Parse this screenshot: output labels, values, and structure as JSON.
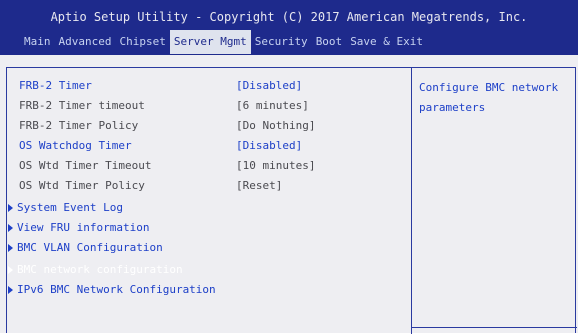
{
  "header": {
    "title": "Aptio Setup Utility - Copyright (C) 2017 American Megatrends, Inc.",
    "tabs": [
      "Main",
      "Advanced",
      "Chipset",
      "Server Mgmt",
      "Security",
      "Boot",
      "Save & Exit"
    ],
    "active_tab": "Server Mgmt"
  },
  "settings": [
    {
      "label": "FRB-2 Timer",
      "value": "[Disabled]"
    },
    {
      "label": "FRB-2 Timer timeout",
      "value": "[6 minutes]"
    },
    {
      "label": "FRB-2 Timer Policy",
      "value": "[Do Nothing]"
    },
    {
      "label": "OS Watchdog Timer",
      "value": "[Disabled]"
    },
    {
      "label": "OS Wtd Timer Timeout",
      "value": "[10 minutes]"
    },
    {
      "label": "OS Wtd Timer Policy",
      "value": "[Reset]"
    }
  ],
  "submenus": [
    {
      "label": "System Event Log"
    },
    {
      "label": "View FRU information"
    },
    {
      "label": "BMC VLAN Configuration"
    },
    {
      "label": "BMC network configuration"
    },
    {
      "label": "IPv6 BMC Network Configuration"
    }
  ],
  "help": {
    "text": "Configure BMC network parameters"
  },
  "colors": {
    "header_bg": "#1e2a8c",
    "body_bg": "#eeeef2",
    "accent_blue": "#1e40c8",
    "selected_text": "#ffffff"
  }
}
